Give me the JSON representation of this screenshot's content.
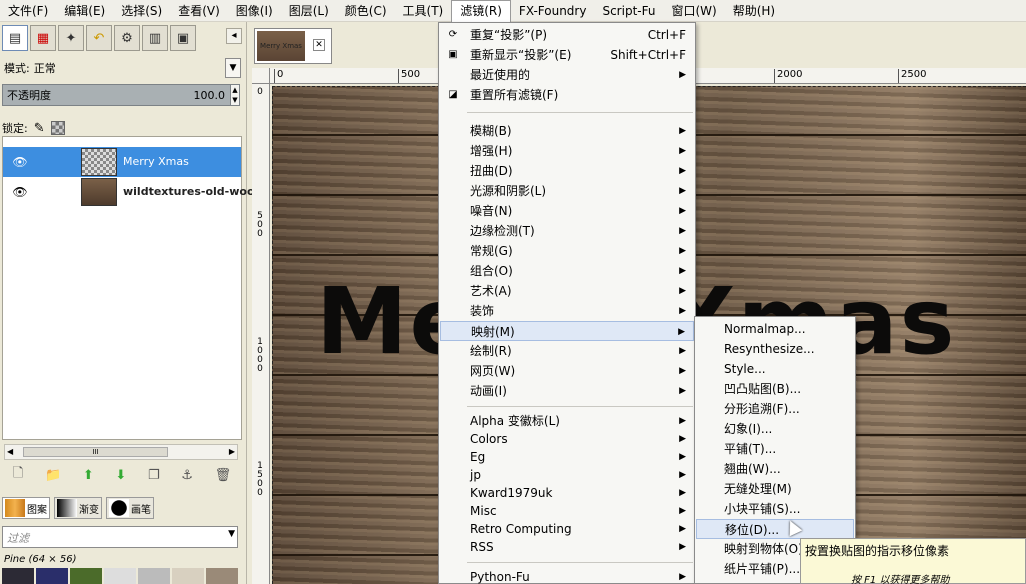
{
  "menubar": [
    "文件(F)",
    "编辑(E)",
    "选择(S)",
    "查看(V)",
    "图像(I)",
    "图层(L)",
    "颜色(C)",
    "工具(T)",
    "滤镜(R)",
    "FX-Foundry",
    "Script-Fu",
    "窗口(W)",
    "帮助(H)"
  ],
  "active_menu_index": 8,
  "layers_panel": {
    "mode_label": "模式:",
    "mode_value": "正常",
    "opacity_label": "不透明度",
    "opacity_value": "100.0",
    "lock_label": "锁定:",
    "layers": [
      {
        "name": "Merry Xmas",
        "selected": true
      },
      {
        "name": "wildtextures-old-wood",
        "selected": false
      }
    ],
    "scroll_grip": "III"
  },
  "brushes_panel": {
    "tabs": [
      "图案",
      "渐变",
      "画笔"
    ],
    "filter_placeholder": "过滤",
    "info": "Pine (64 × 56)"
  },
  "image_tab": {
    "thumb_text": "Merry Xmas"
  },
  "rulers": {
    "top": [
      "0",
      "500",
      "2000",
      "2500"
    ],
    "left": [
      "0",
      "500",
      "1000",
      "1500"
    ]
  },
  "canvas_text": "Merry Xmas",
  "filters_menu": {
    "top_items": [
      {
        "label": "重复“投影”(P)",
        "shortcut": "Ctrl+F",
        "icon": "repeat-icon"
      },
      {
        "label": "重新显示“投影”(E)",
        "shortcut": "Shift+Ctrl+F",
        "icon": "reshow-icon"
      },
      {
        "label": "最近使用的",
        "submenu": true
      },
      {
        "label": "重置所有滤镜(F)",
        "icon": "reset-icon"
      }
    ],
    "category_items": [
      "模糊(B)",
      "增强(H)",
      "扭曲(D)",
      "光源和阴影(L)",
      "噪音(N)",
      "边缘检测(T)",
      "常规(G)",
      "组合(O)",
      "艺术(A)",
      "装饰",
      "映射(M)",
      "绘制(R)",
      "网页(W)",
      "动画(I)"
    ],
    "highlighted_category": "映射(M)",
    "script_items": [
      "Alpha 变徽标(L)",
      "Colors",
      "Eg",
      "jp",
      "Kward1979uk",
      "Misc",
      "Retro Computing",
      "RSS"
    ],
    "python_items": [
      "Python-Fu"
    ]
  },
  "map_submenu": {
    "items": [
      "Normalmap...",
      "Resynthesize...",
      "Style...",
      "凹凸贴图(B)...",
      "分形追溯(F)...",
      "幻象(I)...",
      "平铺(T)...",
      "翘曲(W)...",
      "无缝处理(M)",
      "小块平铺(S)...",
      "移位(D)...",
      "映射到物体(O)...",
      "纸片平铺(P)..."
    ],
    "highlighted": "移位(D)..."
  },
  "tooltip": {
    "text": "按置换贴图的指示移位像素",
    "hint": "按 F1 以获得更多帮助"
  }
}
